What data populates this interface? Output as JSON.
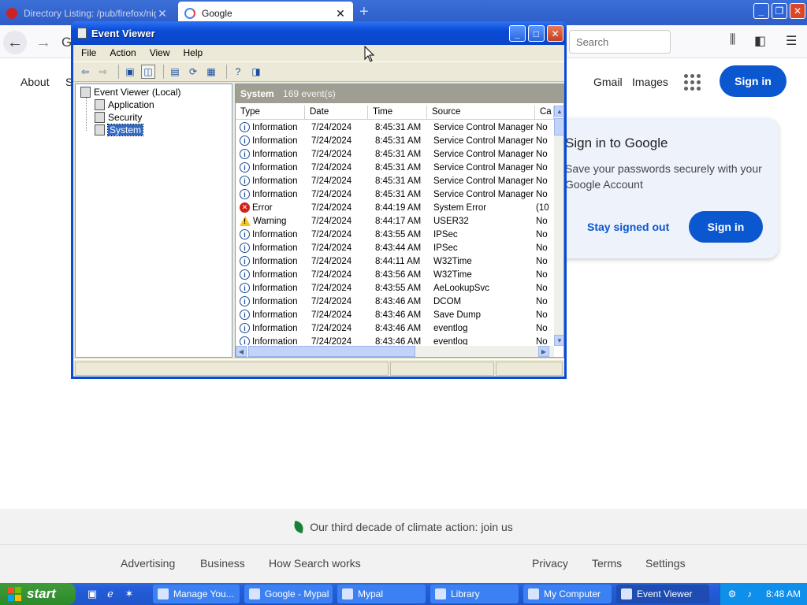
{
  "firefox": {
    "tabs": [
      {
        "label": "Directory Listing: /pub/firefox/nightly",
        "active": false
      },
      {
        "label": "Google",
        "active": true
      }
    ],
    "new_tab_symbol": "+",
    "search_placeholder": "Search",
    "window_buttons": [
      "_",
      "❐",
      "✕"
    ]
  },
  "google": {
    "left_links": [
      "About",
      "S"
    ],
    "right_links": [
      "Gmail",
      "Images"
    ],
    "signin_label": "Sign in",
    "partial_logo": "G",
    "card": {
      "title": "Sign in to Google",
      "body": "Save your passwords securely with your Google Account",
      "stay_label": "Stay signed out",
      "signin_label": "Sign in"
    },
    "footer": {
      "climate": "Our third decade of climate action: join us",
      "left_links": [
        "Advertising",
        "Business",
        "How Search works"
      ],
      "right_links": [
        "Privacy",
        "Terms",
        "Settings"
      ]
    }
  },
  "event_viewer": {
    "title": "Event Viewer",
    "menu": [
      "File",
      "Action",
      "View",
      "Help"
    ],
    "tree": {
      "root": "Event Viewer (Local)",
      "children": [
        "Application",
        "Security",
        "System"
      ],
      "selected": "System"
    },
    "list_title": "System",
    "event_count": "169 event(s)",
    "columns": [
      "Type",
      "Date",
      "Time",
      "Source",
      "Ca"
    ],
    "rows": [
      {
        "type": "Information",
        "date": "7/24/2024",
        "time": "8:45:31 AM",
        "source": "Service Control Manager",
        "cat": "No"
      },
      {
        "type": "Information",
        "date": "7/24/2024",
        "time": "8:45:31 AM",
        "source": "Service Control Manager",
        "cat": "No"
      },
      {
        "type": "Information",
        "date": "7/24/2024",
        "time": "8:45:31 AM",
        "source": "Service Control Manager",
        "cat": "No"
      },
      {
        "type": "Information",
        "date": "7/24/2024",
        "time": "8:45:31 AM",
        "source": "Service Control Manager",
        "cat": "No"
      },
      {
        "type": "Information",
        "date": "7/24/2024",
        "time": "8:45:31 AM",
        "source": "Service Control Manager",
        "cat": "No"
      },
      {
        "type": "Information",
        "date": "7/24/2024",
        "time": "8:45:31 AM",
        "source": "Service Control Manager",
        "cat": "No"
      },
      {
        "type": "Error",
        "date": "7/24/2024",
        "time": "8:44:19 AM",
        "source": "System Error",
        "cat": "(10"
      },
      {
        "type": "Warning",
        "date": "7/24/2024",
        "time": "8:44:17 AM",
        "source": "USER32",
        "cat": "No"
      },
      {
        "type": "Information",
        "date": "7/24/2024",
        "time": "8:43:55 AM",
        "source": "IPSec",
        "cat": "No"
      },
      {
        "type": "Information",
        "date": "7/24/2024",
        "time": "8:43:44 AM",
        "source": "IPSec",
        "cat": "No"
      },
      {
        "type": "Information",
        "date": "7/24/2024",
        "time": "8:44:11 AM",
        "source": "W32Time",
        "cat": "No"
      },
      {
        "type": "Information",
        "date": "7/24/2024",
        "time": "8:43:56 AM",
        "source": "W32Time",
        "cat": "No"
      },
      {
        "type": "Information",
        "date": "7/24/2024",
        "time": "8:43:55 AM",
        "source": "AeLookupSvc",
        "cat": "No"
      },
      {
        "type": "Information",
        "date": "7/24/2024",
        "time": "8:43:46 AM",
        "source": "DCOM",
        "cat": "No"
      },
      {
        "type": "Information",
        "date": "7/24/2024",
        "time": "8:43:46 AM",
        "source": "Save Dump",
        "cat": "No"
      },
      {
        "type": "Information",
        "date": "7/24/2024",
        "time": "8:43:46 AM",
        "source": "eventlog",
        "cat": "No"
      },
      {
        "type": "Information",
        "date": "7/24/2024",
        "time": "8:43:46 AM",
        "source": "eventlog",
        "cat": "No"
      }
    ]
  },
  "taskbar": {
    "start_label": "start",
    "tasks": [
      {
        "label": "Manage You...",
        "active": false
      },
      {
        "label": "Google - Mypal",
        "active": false
      },
      {
        "label": "Mypal",
        "active": false
      },
      {
        "label": "Library",
        "active": false
      },
      {
        "label": "My Computer",
        "active": false
      },
      {
        "label": "Event Viewer",
        "active": true
      }
    ],
    "clock": "8:48 AM"
  },
  "colors": {
    "xp_blue": "#0a4bd6",
    "google_blue": "#0b57d0",
    "start_green": "#3f9a3a",
    "error_red": "#d2201a",
    "warning_yellow": "#f3c51a"
  }
}
